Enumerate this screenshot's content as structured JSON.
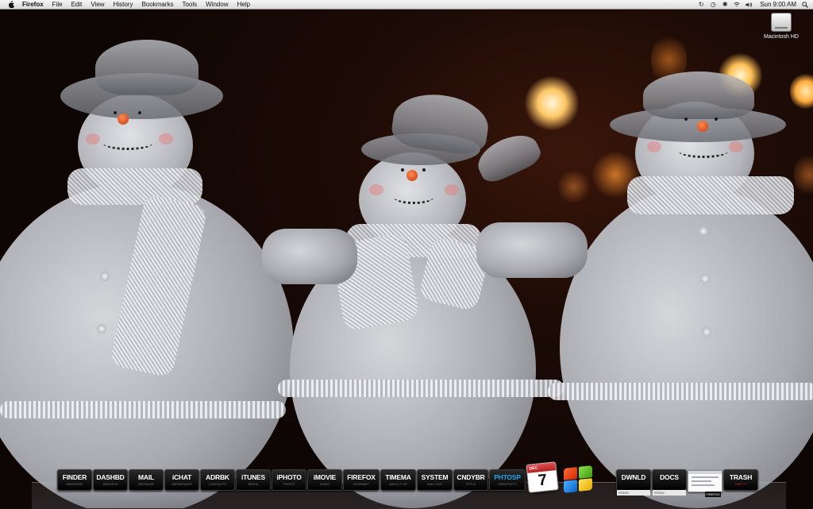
{
  "menubar": {
    "app_name": "Firefox",
    "menus": [
      "File",
      "Edit",
      "View",
      "History",
      "Bookmarks",
      "Tools",
      "Window",
      "Help"
    ],
    "clock": "Sun 9:00 AM"
  },
  "desktop": {
    "drive_label": "Macintosh HD"
  },
  "dock": {
    "items": [
      {
        "label": "FINDER",
        "sub": "HARDDISK"
      },
      {
        "label": "DASHBD",
        "sub": "WIDGETS"
      },
      {
        "label": "MAIL",
        "sub": "MESSAGE"
      },
      {
        "label": "iCHAT",
        "sub": "MESSENGER"
      },
      {
        "label": "ADRBK",
        "sub": "CONTACTS"
      },
      {
        "label": "iTUNES",
        "sub": "MEDIA"
      },
      {
        "label": "iPHOTO",
        "sub": "PHOTO"
      },
      {
        "label": "iMOVIE",
        "sub": "VIDEO"
      },
      {
        "label": "FIREFOX",
        "sub": "INTERNET"
      },
      {
        "label": "TIMEMA",
        "sub": "BACK IT UP"
      },
      {
        "label": "SYSTEM",
        "sub": "MAC OSX"
      },
      {
        "label": "CNDYBR",
        "sub": "STYLE"
      },
      {
        "label": "PHTOSP",
        "sub": "CREATIVITY"
      }
    ],
    "calendar": {
      "month": "DEC",
      "day": "7"
    },
    "stacks": [
      {
        "label": "DWNLD",
        "sub": "STACK"
      },
      {
        "label": "DOCS",
        "sub": "STACK"
      }
    ],
    "firefox_window_tag": "FIREFOX",
    "trash": {
      "label": "TRASH",
      "sub": "EMPTY"
    },
    "accent_color": "#27a4e8"
  }
}
